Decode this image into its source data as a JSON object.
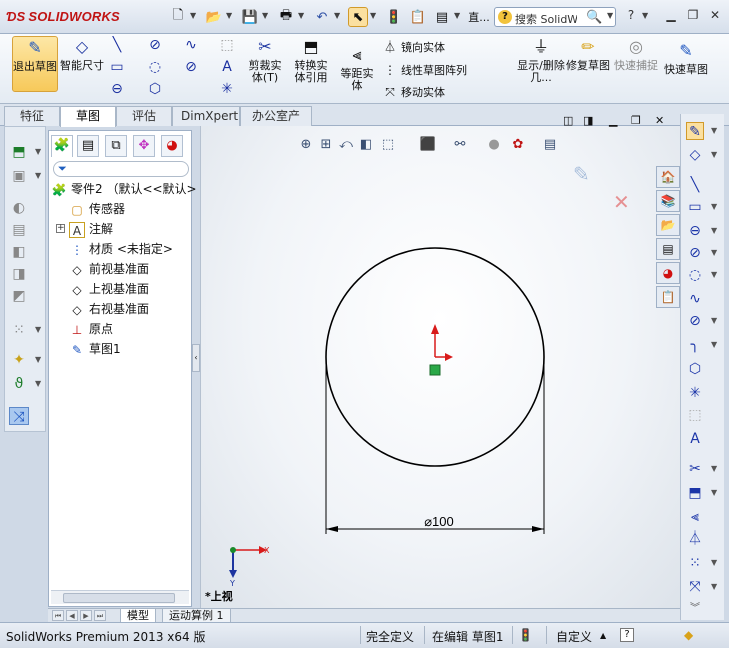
{
  "app": {
    "brand": "SOLIDWORKS",
    "search_placeholder": "搜索 SolidWorks"
  },
  "titlebar": {
    "ellipsis_label": "直..."
  },
  "ribbon": {
    "exit_sketch": "退出草图",
    "smart_dim": "智能尺寸",
    "trim": "剪裁实体(T)",
    "convert": "转换实体引用",
    "offset": "等距实体",
    "mirror": "镜向实体",
    "linear_pattern": "线性草图阵列",
    "move": "移动实体",
    "show_delete": "显示/删除几...",
    "repair": "修复草图",
    "quick_snap": "快速捕捉",
    "quick_sketch": "快速草图"
  },
  "tabs": [
    "特征",
    "草图",
    "评估",
    "DimXpert",
    "办公室产品"
  ],
  "active_tab": 1,
  "tree": {
    "root": "零件2 （默认<<默认>",
    "items": [
      "传感器",
      "注解",
      "材质 <未指定>",
      "前视基准面",
      "上视基准面",
      "右视基准面",
      "原点",
      "草图1"
    ]
  },
  "sketch": {
    "dimension": "⌀100",
    "view_label": "*上视",
    "triad_x": "X",
    "triad_y": "Y"
  },
  "model_tabs": [
    "模型",
    "运动算例 1"
  ],
  "status": {
    "product": "SolidWorks Premium 2013 x64 版",
    "define": "完全定义",
    "editing": "在编辑 草图1",
    "custom": "自定义"
  },
  "colors": {
    "brand_red": "#c01414",
    "sketch_line": "#000000",
    "origin_red": "#d81b1b",
    "active_highlight": "#f7c95a"
  }
}
